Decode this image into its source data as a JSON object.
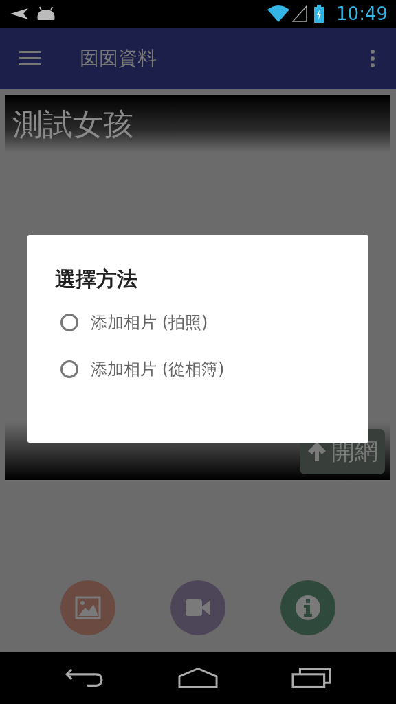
{
  "status_bar": {
    "time": "10:49"
  },
  "app_bar": {
    "title": "囡囡資料"
  },
  "card": {
    "title": "測試女孩",
    "button": "開網"
  },
  "actions": [
    {
      "kind": "image",
      "color": "#6b4a42"
    },
    {
      "kind": "video",
      "color": "#4d4658"
    },
    {
      "kind": "info",
      "color": "#2f4a3c"
    }
  ],
  "dialog": {
    "title": "選擇方法",
    "options": [
      {
        "label": "添加相片 (拍照)",
        "selected": false
      },
      {
        "label": "添加相片 (從相簿)",
        "selected": false
      }
    ]
  }
}
